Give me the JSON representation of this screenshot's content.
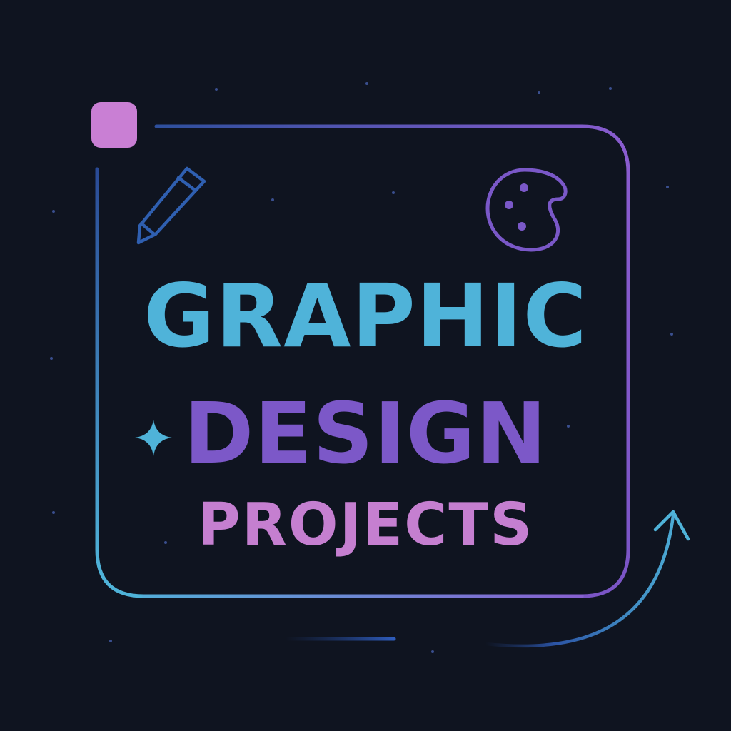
{
  "headline": {
    "line1": "GRAPHIC",
    "line2": "DESIGN",
    "line3": "PROJECTS"
  },
  "colors": {
    "background": "#0f1420",
    "cyan": "#4fb3d9",
    "purple": "#7c58c8",
    "violet": "#c57fd0",
    "blue": "#2d5aa8",
    "pink_square": "#c97fd4"
  },
  "icons": {
    "pencil": "pencil-icon",
    "palette": "palette-icon",
    "sparkle": "sparkle-icon",
    "arrow": "curved-arrow-icon",
    "square": "pink-square"
  }
}
